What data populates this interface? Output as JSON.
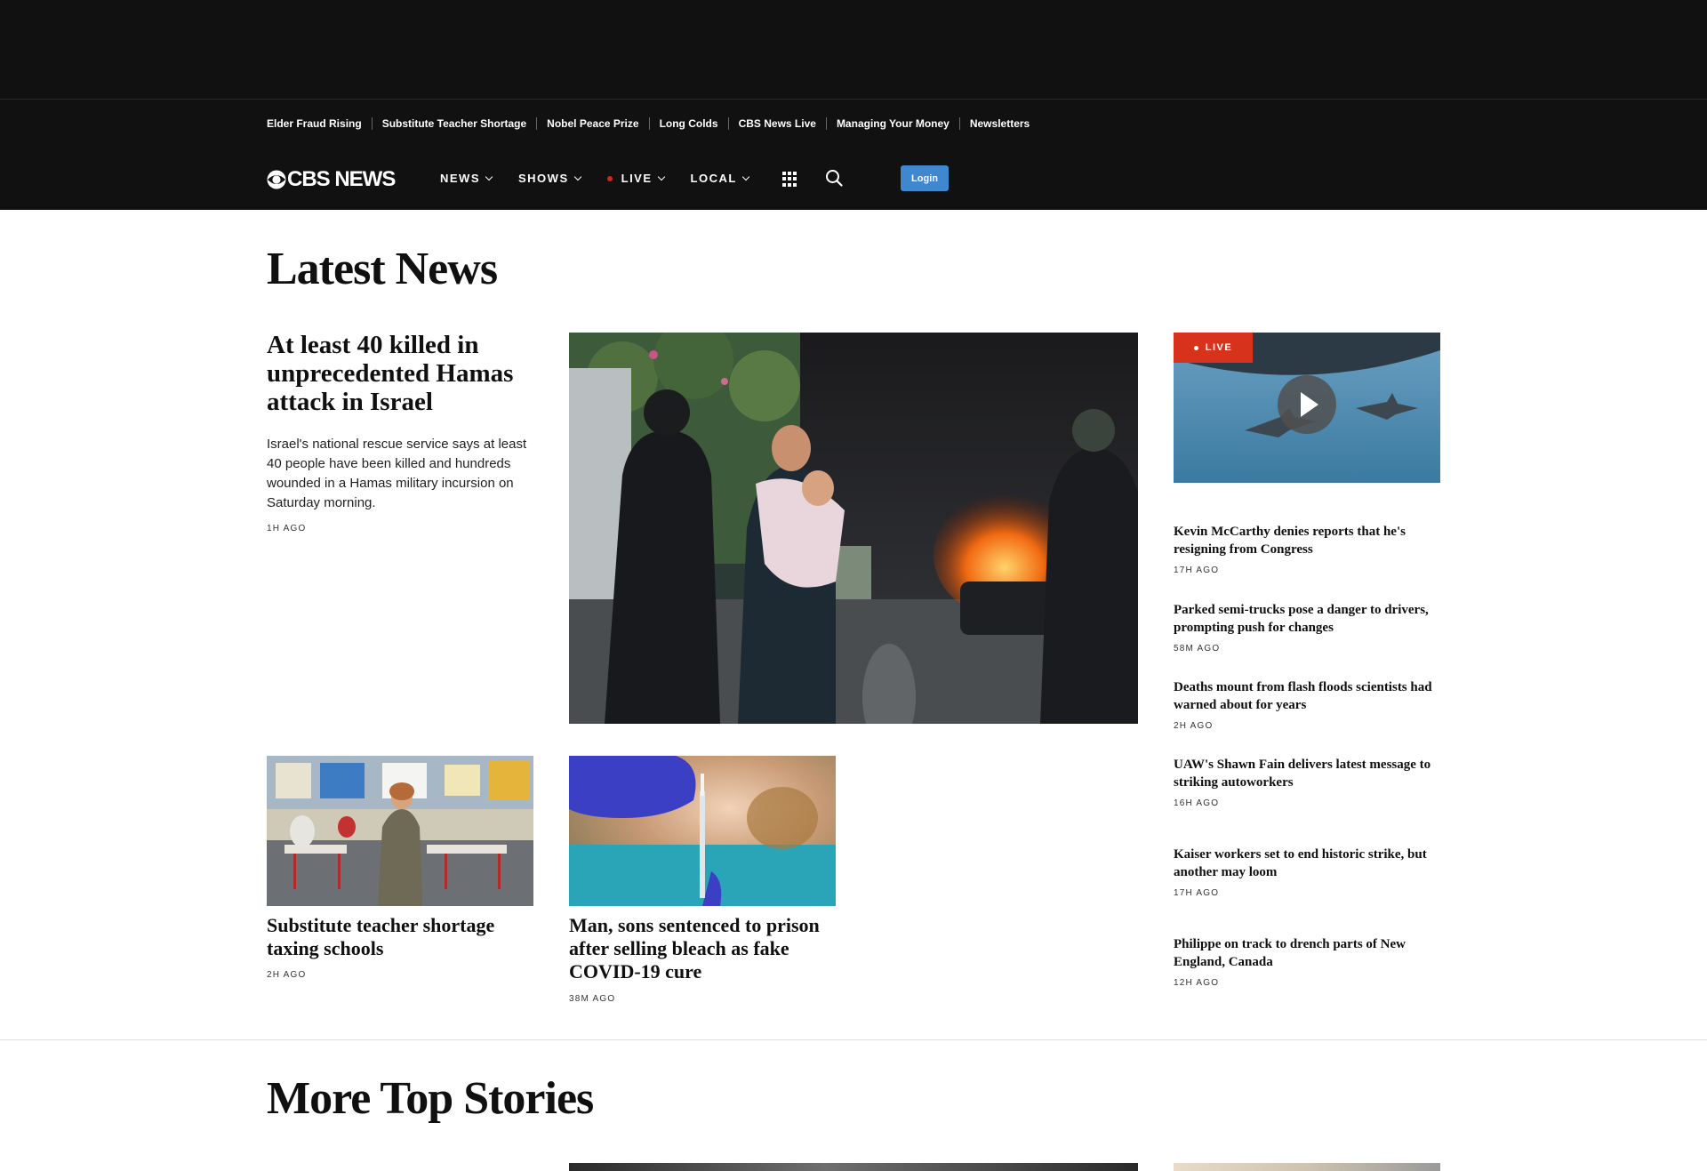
{
  "trending": [
    "Elder Fraud Rising",
    "Substitute Teacher Shortage",
    "Nobel Peace Prize",
    "Long Colds",
    "CBS News Live",
    "Managing Your Money",
    "Newsletters"
  ],
  "nav": {
    "logo": "CBS NEWS",
    "items": [
      "NEWS",
      "SHOWS",
      "LIVE",
      "LOCAL"
    ],
    "login": "Login"
  },
  "latest": {
    "title": "Latest News",
    "lead": {
      "headline": "At least 40 killed in unprecedented Hamas attack in Israel",
      "dek": "Israel's national rescue service says at least 40 people have been killed and hundreds wounded in a Hamas military incursion on Saturday morning.",
      "time": "1H AGO"
    },
    "cards": [
      {
        "headline": "Substitute teacher shortage taxing schools",
        "time": "2H AGO"
      },
      {
        "headline": "Man, sons sentenced to prison after selling bleach as fake COVID-19 cure",
        "time": "38M AGO"
      }
    ],
    "live_badge": "LIVE",
    "sidebar": [
      {
        "headline": "Kevin McCarthy denies reports that he's resigning from Congress",
        "time": "17H AGO"
      },
      {
        "headline": "Parked semi-trucks pose a danger to drivers, prompting push for changes",
        "time": "58M AGO"
      },
      {
        "headline": "Deaths mount from flash floods scientists had warned about for years",
        "time": "2H AGO"
      },
      {
        "headline": "UAW's Shawn Fain delivers latest message to striking autoworkers",
        "time": "16H AGO"
      },
      {
        "headline": "Kaiser workers set to end historic strike, but another may loom",
        "time": "17H AGO"
      },
      {
        "headline": "Philippe on track to drench parts of New England, Canada",
        "time": "12H AGO"
      }
    ]
  },
  "more": {
    "title": "More Top Stories"
  },
  "colors": {
    "header_bg": "#111112",
    "login_button": "#3f87cf",
    "live_red": "#d6321c"
  }
}
